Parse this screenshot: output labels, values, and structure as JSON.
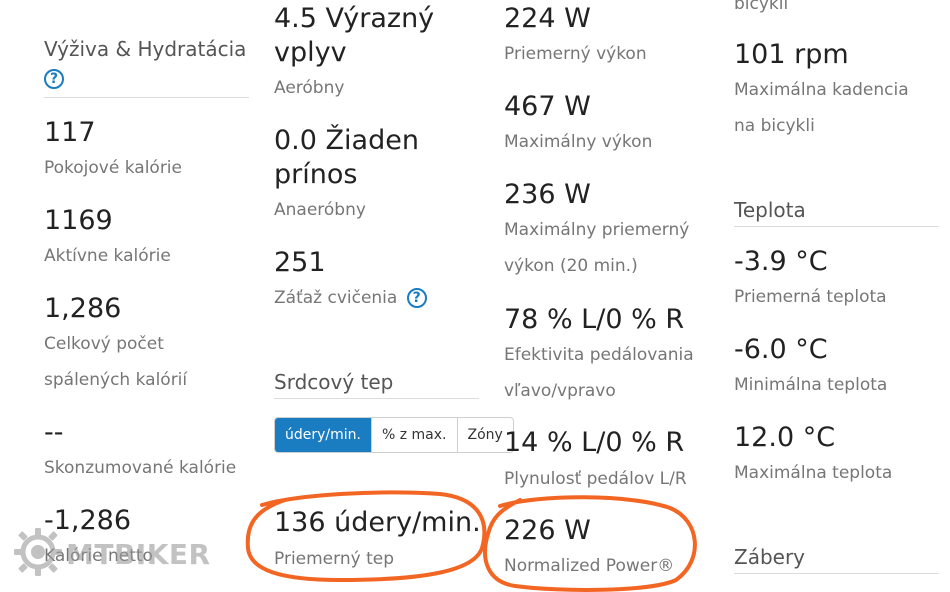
{
  "col1": {
    "section_title": "Výživa & Hydratácia",
    "stats": [
      {
        "value": "117",
        "label": "Pokojové kalórie"
      },
      {
        "value": "1169",
        "label": "Aktívne kalórie"
      },
      {
        "value": "1,286",
        "label_lines": [
          "Celkový počet",
          "spálených kalórií"
        ]
      },
      {
        "value": "--",
        "label": "Skonzumované kalórie"
      },
      {
        "value": "-1,286",
        "label": "Kalórie netto"
      }
    ]
  },
  "col2": {
    "training_effect": [
      {
        "value_lines": [
          "4.5 Výrazný",
          "vplyv"
        ],
        "label": "Aeróbny"
      },
      {
        "value_lines": [
          "0.0 Žiaden",
          "prínos"
        ],
        "label": "Anaeróbny"
      }
    ],
    "load": {
      "value": "251",
      "label": "Záťaž cvičenia"
    },
    "hr_section_title": "Srdcový tep",
    "hr_units": {
      "options": [
        "údery/min.",
        "% z max.",
        "Zóny"
      ],
      "selected": "údery/min."
    },
    "avg_hr": {
      "value": "136 údery/min.",
      "label": "Priemerný tep"
    }
  },
  "col3": {
    "stats": [
      {
        "value": "224 W",
        "label": "Priemerný výkon"
      },
      {
        "value": "467 W",
        "label": "Maximálny výkon"
      },
      {
        "value": "236 W",
        "label_lines": [
          "Maximálny priemerný",
          "výkon (20 min.)"
        ]
      },
      {
        "value": "78 % L/0 % R",
        "label_lines": [
          "Efektivita pedálovania",
          "vľavo/vpravo"
        ]
      },
      {
        "value": "14 % L/0 % R",
        "label": "Plynulosť pedálov L/R"
      },
      {
        "value": "226 W",
        "label": "Normalized Power®"
      }
    ]
  },
  "col4": {
    "cut_label": "bicykli",
    "cadence": {
      "value": "101 rpm",
      "label_lines": [
        "Maximálna kadencia",
        "na bicykli"
      ]
    },
    "temp_section_title": "Teplota",
    "temps": [
      {
        "value": "-3.9 °C",
        "label": "Priemerná teplota"
      },
      {
        "value": "-6.0 °C",
        "label": "Minimálna teplota"
      },
      {
        "value": "12.0 °C",
        "label": "Maximálna teplota"
      }
    ],
    "next_section_title": "Zábery"
  },
  "watermark": {
    "text": "MTBIKER"
  },
  "colors": {
    "accent": "#1a7cc1",
    "annotation": "#f26522",
    "label": "#767676",
    "value": "#222222"
  },
  "icons": {
    "help": "help-circle-icon",
    "watermark_logo": "gear-icon"
  }
}
